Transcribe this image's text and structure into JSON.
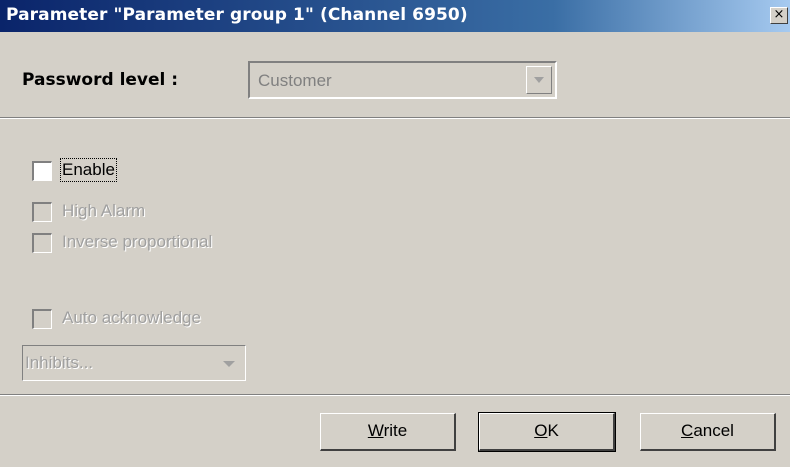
{
  "window": {
    "title": "Parameter \"Parameter group 1\" (Channel 6950)",
    "close_glyph": "×"
  },
  "password": {
    "label": "Password level :",
    "selected_value": "Customer",
    "enabled": false
  },
  "checkboxes": [
    {
      "label": "Enable",
      "checked": false,
      "enabled": true,
      "focused": true
    },
    {
      "label": "High Alarm",
      "checked": false,
      "enabled": false
    },
    {
      "label": "Inverse proportional",
      "checked": false,
      "enabled": false
    },
    {
      "label": "Auto acknowledge",
      "checked": false,
      "enabled": false
    }
  ],
  "inhibits": {
    "label": "Inhibits...",
    "enabled": false
  },
  "buttons": {
    "write": {
      "mnemonic": "W",
      "rest": "rite"
    },
    "ok": {
      "mnemonic": "O",
      "rest": "K"
    },
    "cancel": {
      "mnemonic": "C",
      "rest": "ancel"
    }
  },
  "colors": {
    "dialog_background": "#d4d0c8",
    "title_gradient_start": "#0a246a",
    "title_gradient_end": "#a6caf0",
    "disabled_text": "#a0a0a0"
  },
  "icons": {
    "close": "close-icon",
    "combo_arrow": "chevron-down-icon",
    "inhibits_arrow": "chevron-down-icon"
  }
}
